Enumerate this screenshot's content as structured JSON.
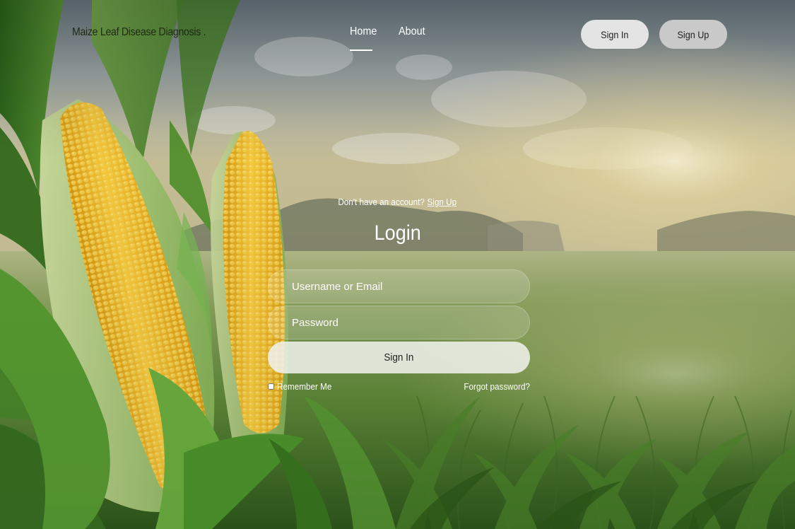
{
  "header": {
    "brand": "Maize Leaf Disease Diagnosis .",
    "nav": [
      {
        "label": "Home",
        "active": true
      },
      {
        "label": "About",
        "active": false
      }
    ],
    "signin_label": "Sign In",
    "signup_label": "Sign Up"
  },
  "login": {
    "prompt_text": "Don't have an account?",
    "prompt_link": "Sign Up",
    "title": "Login",
    "username_placeholder": "Username or Email",
    "password_placeholder": "Password",
    "submit_label": "Sign In",
    "remember_label": "Remember Me",
    "forgot_label": "Forgot password?"
  },
  "colors": {
    "sky": "#8fa0a8",
    "field_green": "#5f8a3a",
    "corn_yellow": "#f2b82a",
    "button_light": "#e4e4e4",
    "button_grey": "#c9c9c9"
  }
}
